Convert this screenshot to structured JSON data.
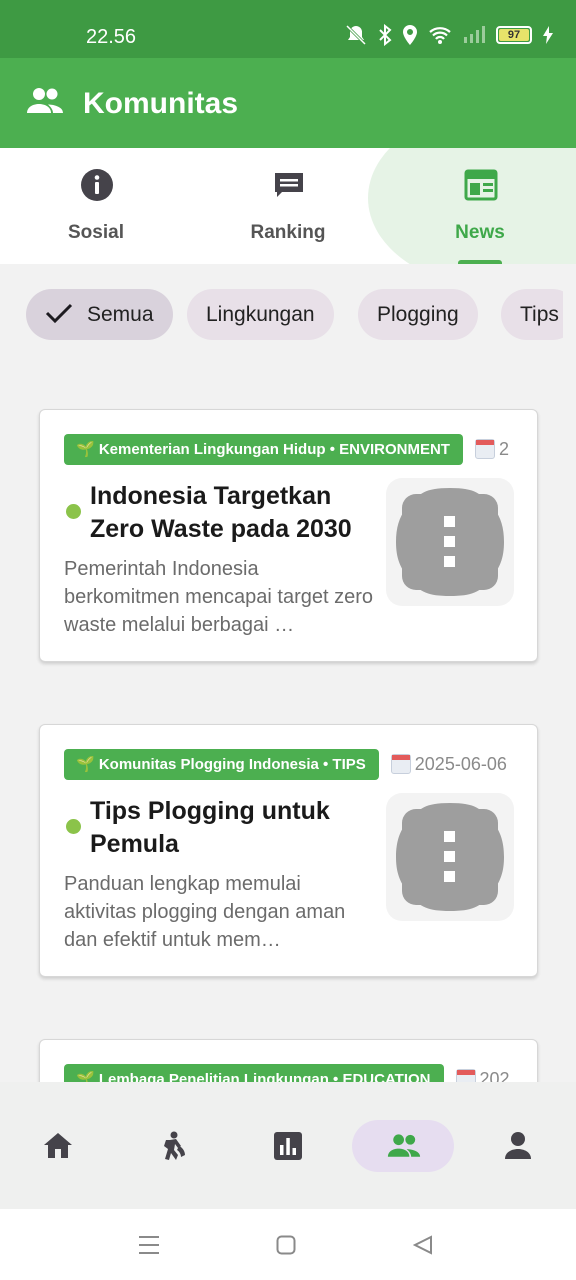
{
  "status_bar": {
    "time": "22.56",
    "battery": "97"
  },
  "app_bar": {
    "title": "Komunitas",
    "icon": "people-icon"
  },
  "tabs": [
    {
      "label": "Sosial",
      "icon": "info-icon",
      "active": false
    },
    {
      "label": "Ranking",
      "icon": "chat-icon",
      "active": false
    },
    {
      "label": "News",
      "icon": "newspaper-icon",
      "active": true
    }
  ],
  "chips": [
    {
      "label": "Semua",
      "selected": true
    },
    {
      "label": "Lingkungan",
      "selected": false
    },
    {
      "label": "Plogging",
      "selected": false
    },
    {
      "label": "Tips",
      "selected": false
    }
  ],
  "articles": [
    {
      "source_badge": "🌱 Kementerian Lingkungan Hidup • ENVIRONMENT",
      "date": "2",
      "title": "Indonesia Targetkan Zero Waste pada 2030",
      "excerpt": "Pemerintah Indonesia berkomitmen mencapai target zero waste melalui berbagai …"
    },
    {
      "source_badge": "🌱 Komunitas Plogging Indonesia • TIPS",
      "date": "2025-06-06",
      "title": "Tips Plogging untuk Pemula",
      "excerpt": "Panduan lengkap memulai aktivitas plogging dengan aman dan efektif untuk mem…"
    },
    {
      "source_badge": "🌱 Lembaga Penelitian Lingkungan • EDUCATION",
      "date": "202",
      "title": "",
      "excerpt": ""
    }
  ],
  "bottom_nav": [
    {
      "icon": "home-icon",
      "active": false
    },
    {
      "icon": "plogging-icon",
      "active": false
    },
    {
      "icon": "bar-chart-icon",
      "active": false
    },
    {
      "icon": "people-icon",
      "active": true
    },
    {
      "icon": "person-icon",
      "active": false
    }
  ],
  "colors": {
    "primary": "#4caf50",
    "status_bar": "#3e9a43",
    "active_nav_bg": "#e6ddf0",
    "dot": "#8bc34a"
  }
}
